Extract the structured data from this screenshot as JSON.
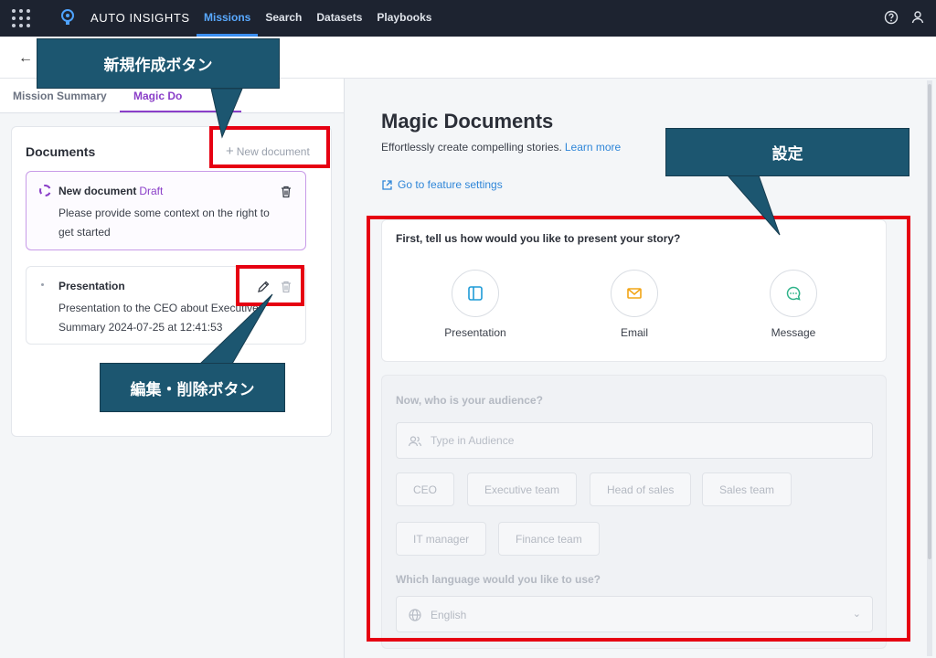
{
  "topbar": {
    "brand": "AUTO INSIGHTS",
    "nav": [
      {
        "label": "Missions",
        "active": true
      },
      {
        "label": "Search",
        "active": false
      },
      {
        "label": "Datasets",
        "active": false
      },
      {
        "label": "Playbooks",
        "active": false
      }
    ],
    "icons": [
      "apps-grid-icon",
      "lightbulb-icon",
      "help-icon",
      "user-icon"
    ]
  },
  "subheader": {
    "back_icon": "arrow-left-icon"
  },
  "left_panel": {
    "tabs": [
      {
        "label": "Mission Summary",
        "active": false
      },
      {
        "label": "Magic Do",
        "active": true
      }
    ],
    "documents": {
      "title": "Documents",
      "new_document_label": "New document",
      "items": [
        {
          "name": "New document",
          "status": "Draft",
          "description": "Please provide some context on the right to\nget started"
        },
        {
          "name": "Presentation",
          "status": "",
          "description": "Presentation to the CEO about Executive\nSummary 2024-07-25 at 12:41:53"
        }
      ]
    }
  },
  "main": {
    "title": "Magic Documents",
    "subtitle": "Effortlessly create compelling stories.",
    "learn_more": "Learn more",
    "feature_link": "Go to feature settings",
    "present_question": "First, tell us how would you like to present your story?",
    "present_options": [
      {
        "label": "Presentation",
        "icon": "presentation-icon",
        "color": "#1e9bd7"
      },
      {
        "label": "Email",
        "icon": "email-icon",
        "color": "#f2a516"
      },
      {
        "label": "Message",
        "icon": "message-icon",
        "color": "#2fb38a"
      }
    ],
    "audience_question": "Now, who is your audience?",
    "audience_placeholder": "Type in Audience",
    "audience_chips": [
      "CEO",
      "Executive team",
      "Head of sales",
      "Sales team",
      "IT manager",
      "Finance team"
    ],
    "language_question": "Which language would you like to use?",
    "language_value": "English"
  },
  "annotations": {
    "new_button": "新規作成ボタン",
    "settings": "設定",
    "edit_delete": "編集・削除ボタン"
  },
  "colors": {
    "nav_bg": "#1d2330",
    "accent_purple": "#8a3ec8",
    "link_blue": "#2f86d8",
    "annotation_red": "#e60012",
    "callout_bg": "#1c5670"
  }
}
